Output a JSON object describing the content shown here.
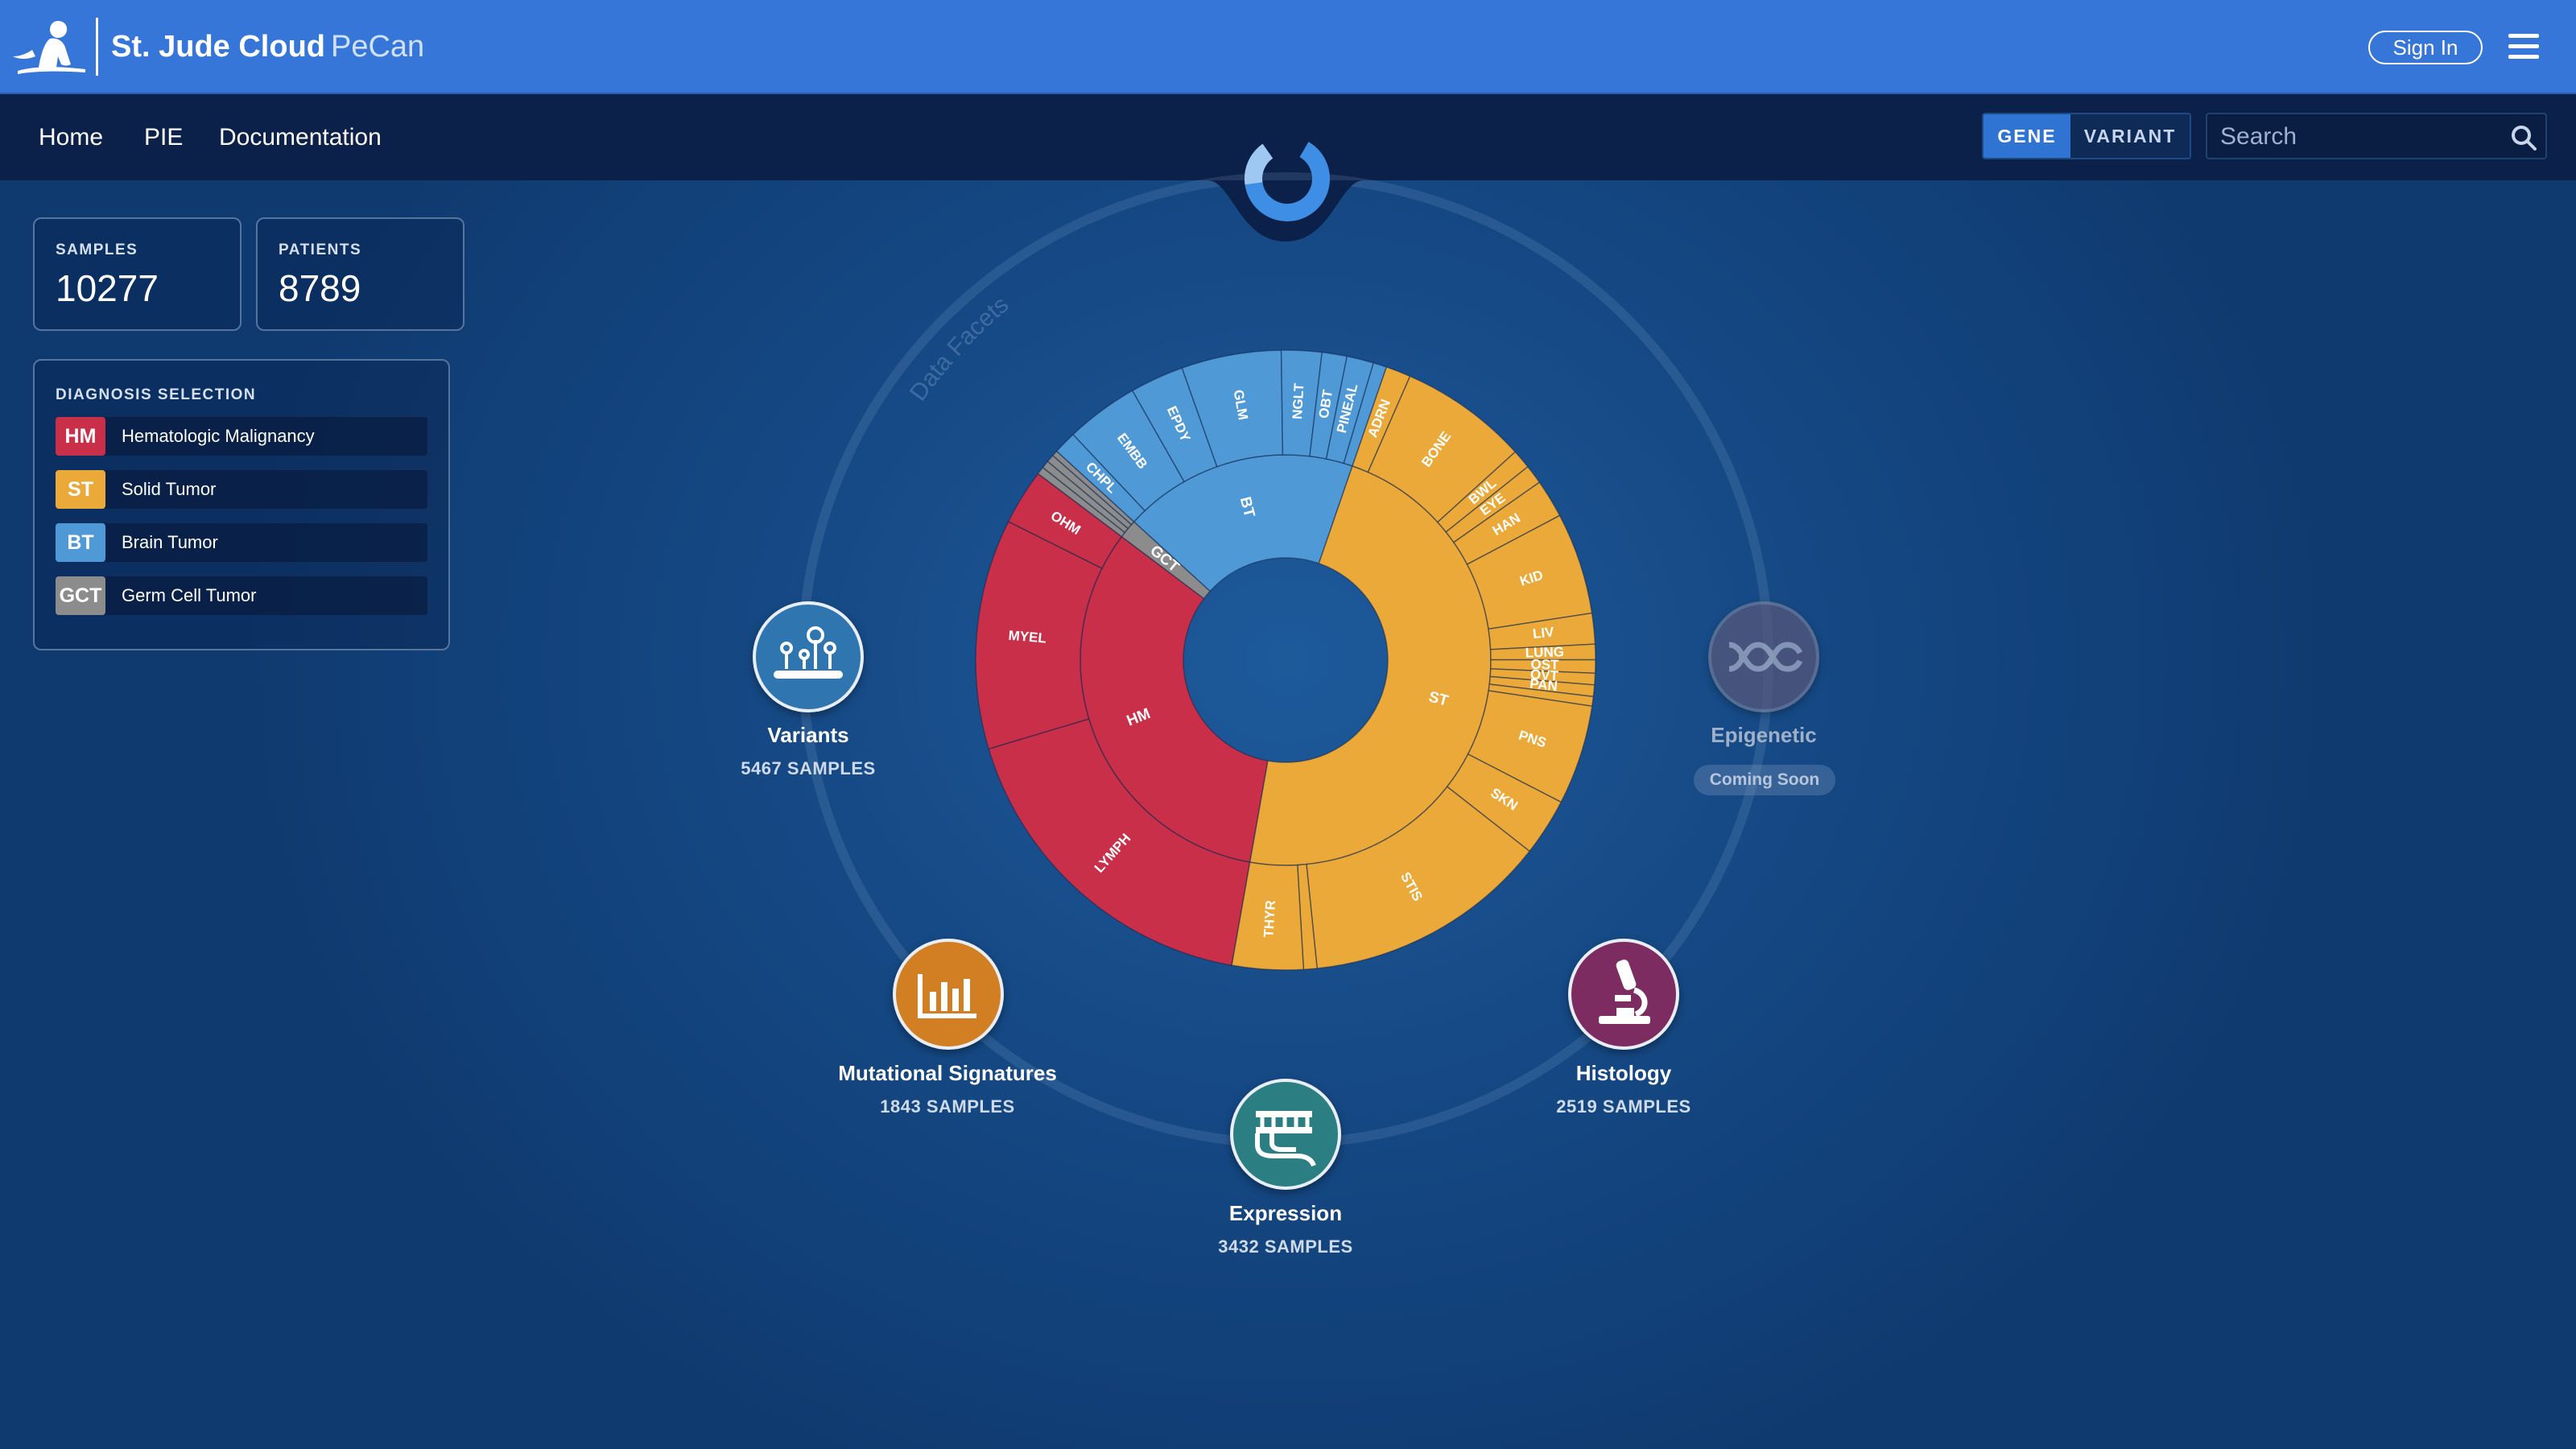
{
  "header": {
    "brand_name": "St. Jude Cloud",
    "brand_product": "PeCan",
    "sign_in_label": "Sign In",
    "menu_icon": "hamburger-menu-icon",
    "logo_icon": "st-jude-statue-logo"
  },
  "nav": {
    "links": [
      "Home",
      "PIE",
      "Documentation"
    ],
    "search_mode_options": [
      "GENE",
      "VARIANT"
    ],
    "search_mode_selected": "GENE",
    "search_placeholder": "Search",
    "search_icon": "search-icon"
  },
  "stats": {
    "samples": {
      "label": "SAMPLES",
      "value": "10277"
    },
    "patients": {
      "label": "PATIENTS",
      "value": "8789"
    }
  },
  "diagnosis": {
    "title": "DIAGNOSIS SELECTION",
    "items": [
      {
        "code": "HM",
        "name": "Hematologic Malignancy",
        "color": "#c92f48"
      },
      {
        "code": "ST",
        "name": "Solid Tumor",
        "color": "#eba93a"
      },
      {
        "code": "BT",
        "name": "Brain Tumor",
        "color": "#4f9ad6"
      },
      {
        "code": "GCT",
        "name": "Germ Cell Tumor",
        "color": "#8c8c8c"
      }
    ]
  },
  "data_facets_label": "Data Facets",
  "facets": {
    "variants": {
      "name": "Variants",
      "count": "5467 SAMPLES",
      "icon": "variants-icon",
      "color": "#2f76b0"
    },
    "mutational": {
      "name": "Mutational Signatures",
      "count": "1843 SAMPLES",
      "icon": "bar-chart-icon",
      "color": "#d27f23"
    },
    "expression": {
      "name": "Expression",
      "count": "3432 SAMPLES",
      "icon": "expression-icon",
      "color": "#2b7f82"
    },
    "histology": {
      "name": "Histology",
      "count": "2519 SAMPLES",
      "icon": "microscope-icon",
      "color": "#7d2c62"
    },
    "epigenetic": {
      "name": "Epigenetic",
      "status": "Coming Soon",
      "icon": "dna-icon",
      "color": "#55577a"
    }
  },
  "chart_data": {
    "type": "sunburst",
    "colors": {
      "HM": "#c92f48",
      "ST": "#eba93a",
      "BT": "#4f9ad6",
      "GCT": "#8c8c8c"
    },
    "inner_ring": [
      {
        "label": "HM",
        "value": 32.5
      },
      {
        "label": "GCT",
        "value": 1.5
      },
      {
        "label": "BT",
        "value": 18.5
      },
      {
        "label": "ST",
        "value": 47.5
      }
    ],
    "outer_ring": [
      {
        "group": "HM",
        "label": "LYMPH",
        "value": 17.6
      },
      {
        "group": "HM",
        "label": "MYEL",
        "value": 12
      },
      {
        "group": "HM",
        "label": "OHM",
        "value": 2.9
      },
      {
        "group": "GCT",
        "label": "",
        "value": 0.4
      },
      {
        "group": "GCT",
        "label": "",
        "value": 0.4
      },
      {
        "group": "GCT",
        "label": "",
        "value": 0.4
      },
      {
        "group": "GCT",
        "label": "",
        "value": 0.3
      },
      {
        "group": "BT",
        "label": "CHPL",
        "value": 1.2
      },
      {
        "group": "BT",
        "label": "EMBB",
        "value": 3.8
      },
      {
        "group": "BT",
        "label": "EPDY",
        "value": 2.8
      },
      {
        "group": "BT",
        "label": "GLM",
        "value": 5.2
      },
      {
        "group": "BT",
        "label": "NGLT",
        "value": 2.1
      },
      {
        "group": "BT",
        "label": "OBT",
        "value": 1.3
      },
      {
        "group": "BT",
        "label": "PINEAL",
        "value": 1.4
      },
      {
        "group": "BT",
        "label": "",
        "value": 0.7
      },
      {
        "group": "ST",
        "label": "ADRN",
        "value": 1.3
      },
      {
        "group": "ST",
        "label": "BONE",
        "value": 6.7
      },
      {
        "group": "ST",
        "label": "BWL",
        "value": 1
      },
      {
        "group": "ST",
        "label": "EYE",
        "value": 1
      },
      {
        "group": "ST",
        "label": "HAN",
        "value": 2
      },
      {
        "group": "ST",
        "label": "KID",
        "value": 5.3
      },
      {
        "group": "ST",
        "label": "LIV",
        "value": 1.6
      },
      {
        "group": "ST",
        "label": "LUNG",
        "value": 0.8
      },
      {
        "group": "ST",
        "label": "OST",
        "value": 0.7
      },
      {
        "group": "ST",
        "label": "OVT",
        "value": 0.6
      },
      {
        "group": "ST",
        "label": "PAN",
        "value": 0.6
      },
      {
        "group": "ST",
        "label": "",
        "value": 0.5
      },
      {
        "group": "ST",
        "label": "PNS",
        "value": 5.2
      },
      {
        "group": "ST",
        "label": "SKN",
        "value": 3
      },
      {
        "group": "ST",
        "label": "STIS",
        "value": 12.8
      },
      {
        "group": "ST",
        "label": "",
        "value": 0.7
      },
      {
        "group": "ST",
        "label": "THYR",
        "value": 3.7
      }
    ]
  }
}
